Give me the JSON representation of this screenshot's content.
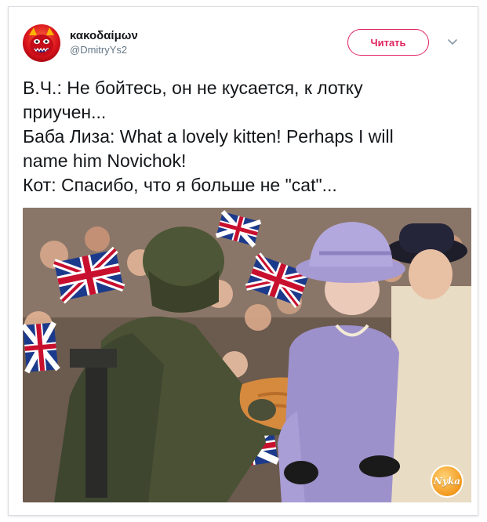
{
  "tweet": {
    "author": {
      "display_name": "κακοδαίμων",
      "handle": "@DmitryYs2",
      "avatar_icon": "red-demon-avatar-icon"
    },
    "follow_label": "Читать",
    "menu_icon": "chevron-down-icon",
    "text_lines": [
      "В.Ч.: Не бойтесь, он не кусается, к лотку",
      "приучен...",
      "Баба Лиза: What a lovely kitten! Perhaps I will",
      "name him Novichok!",
      "Кот: Спасибо, что я больше не \"cat\"..."
    ],
    "photo_watermark": "Nyka"
  },
  "colors": {
    "accent": "#e0245e",
    "text": "#14171a",
    "muted": "#657786",
    "border": "#d8dde2"
  }
}
